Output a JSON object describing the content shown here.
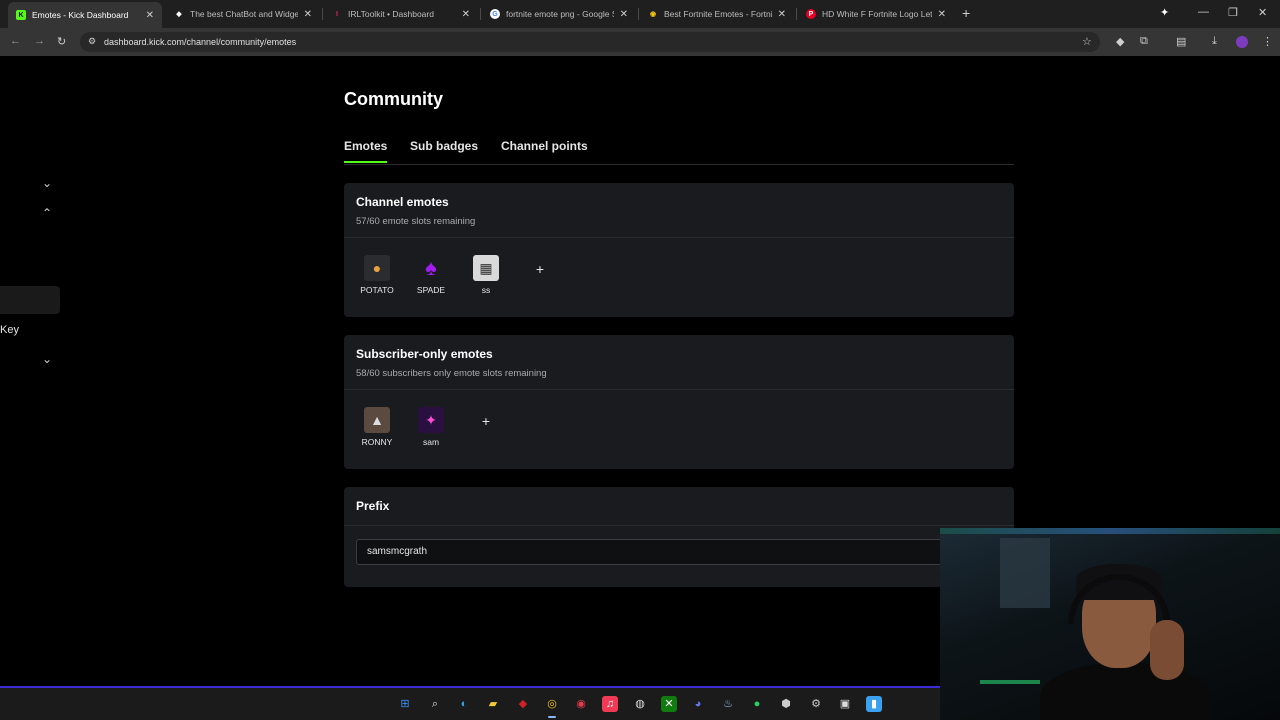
{
  "browser": {
    "tabs": [
      {
        "title": "Emotes - Kick Dashboard",
        "icon": "kick-icon",
        "icon_glyph": "K",
        "icon_color": "#53fc18",
        "active": true
      },
      {
        "title": "The best ChatBot and Widgets",
        "icon": "botrix-icon",
        "icon_glyph": "◆",
        "icon_color": "#ffffff",
        "active": false
      },
      {
        "title": "IRLToolkit • Dashboard",
        "icon": "irltoolkit-icon",
        "icon_glyph": "I",
        "icon_color": "#e0245e",
        "active": false
      },
      {
        "title": "fortnite emote png - Google Se",
        "icon": "google-icon",
        "icon_glyph": "G",
        "icon_color": "#ffffff",
        "active": false
      },
      {
        "title": "Best Fortnite Emotes - Fortnite",
        "icon": "fortnite-site-icon",
        "icon_glyph": "◉",
        "icon_color": "#f5c518",
        "active": false
      },
      {
        "title": "HD White F Fortnite Logo Lette",
        "icon": "pinterest-icon",
        "icon_glyph": "P",
        "icon_color": "#e60023",
        "active": false
      }
    ],
    "url": "dashboard.kick.com/channel/community/emotes"
  },
  "sidebar": {
    "visible_text": "Key"
  },
  "page": {
    "title": "Community",
    "tabs": [
      {
        "label": "Emotes",
        "active": true
      },
      {
        "label": "Sub badges",
        "active": false
      },
      {
        "label": "Channel points",
        "active": false
      }
    ],
    "channel_emotes": {
      "title": "Channel emotes",
      "subtitle": "57/60 emote slots remaining",
      "emotes": [
        {
          "name": "POTATO",
          "icon": "potato-emote-icon",
          "glyph": "🥔",
          "bg": "#2a2c30"
        },
        {
          "name": "SPADE",
          "icon": "spade-emote-icon",
          "glyph": "♠",
          "bg": "#191b1f"
        },
        {
          "name": "ss",
          "icon": "ss-emote-icon",
          "glyph": "▦",
          "bg": "#d9d9d9"
        }
      ],
      "add_label": "+"
    },
    "subscriber_emotes": {
      "title": "Subscriber-only emotes",
      "subtitle": "58/60 subscribers only emote slots remaining",
      "emotes": [
        {
          "name": "RONNY",
          "icon": "ronny-emote-icon",
          "glyph": "▲",
          "bg": "#5a4a40"
        },
        {
          "name": "sam",
          "icon": "sam-emote-icon",
          "glyph": "✦",
          "bg": "#2a1040"
        }
      ],
      "add_label": "+"
    },
    "prefix": {
      "title": "Prefix",
      "value": "samsmcgrath"
    }
  },
  "colors": {
    "accent": "#53fc18",
    "card_bg": "#191b1f",
    "page_bg": "#000000"
  }
}
